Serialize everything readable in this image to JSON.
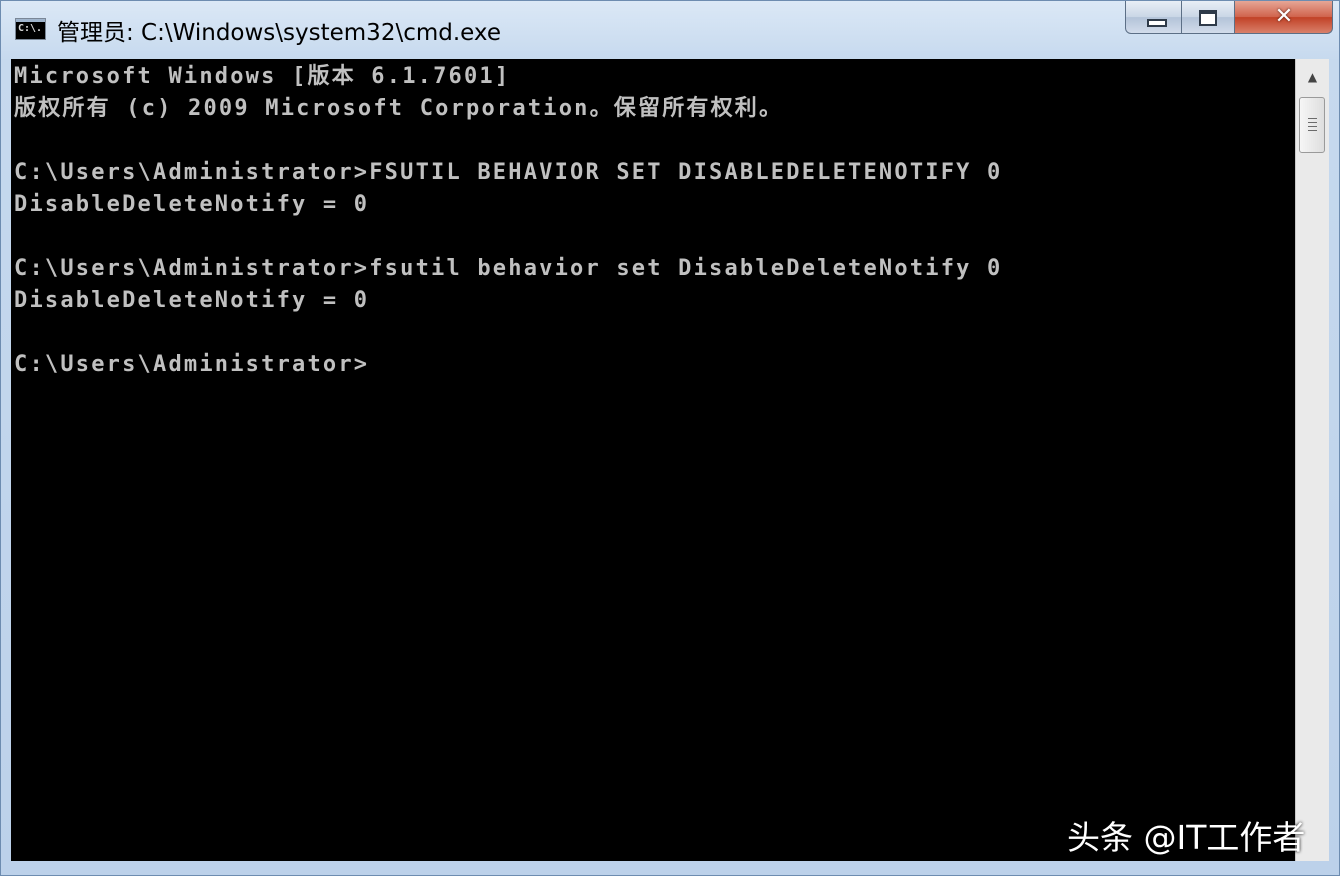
{
  "window": {
    "title": "管理员: C:\\Windows\\system32\\cmd.exe",
    "icon": "cmd-icon",
    "icon_text": "C:\\.",
    "controls": {
      "minimize_icon": "minimize-icon",
      "maximize_icon": "maximize-icon",
      "close_icon": "close-icon",
      "close_glyph": "✕",
      "close_color": "#c14126"
    }
  },
  "console": {
    "background": "#000000",
    "foreground": "#c0c0c0",
    "lines": [
      "Microsoft Windows [版本 6.1.7601]",
      "版权所有 (c) 2009 Microsoft Corporation。保留所有权利。",
      "",
      "C:\\Users\\Administrator>FSUTIL BEHAVIOR SET DISABLEDELETENOTIFY 0",
      "DisableDeleteNotify = 0",
      "",
      "C:\\Users\\Administrator>fsutil behavior set DisableDeleteNotify 0",
      "DisableDeleteNotify = 0",
      "",
      "C:\\Users\\Administrator>"
    ]
  },
  "scrollbar": {
    "up_arrow": "▲"
  },
  "watermark": "头条 @IT工作者"
}
